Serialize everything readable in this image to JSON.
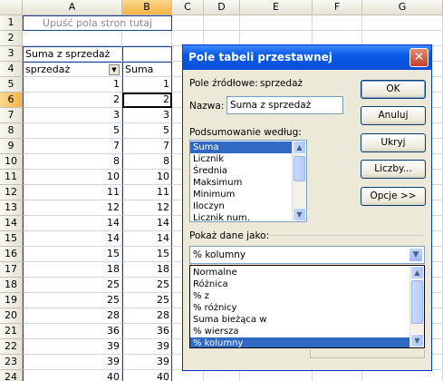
{
  "sheet": {
    "columns": [
      "A",
      "B",
      "C",
      "D",
      "E",
      "F",
      "G"
    ],
    "selected_column": "B",
    "rows": [
      "1",
      "2",
      "3",
      "4",
      "5",
      "6",
      "7",
      "8",
      "9",
      "10",
      "11",
      "12",
      "13",
      "14",
      "15",
      "16",
      "17",
      "18",
      "19",
      "20",
      "21",
      "22",
      "23",
      "24"
    ],
    "selected_row": "6",
    "page_drop_hint": "Upuść pola stron tutaj",
    "pivot_title": "Suma z sprzedaż",
    "row_field": "sprzedaż",
    "data_header": "Suma",
    "col_a_values": [
      "1",
      "2",
      "3",
      "5",
      "7",
      "8",
      "10",
      "11",
      "12",
      "14",
      "14",
      "15",
      "18",
      "25",
      "25",
      "28",
      "36",
      "39",
      "39",
      "40"
    ],
    "col_b_values": [
      "1",
      "2",
      "3",
      "5",
      "7",
      "8",
      "10",
      "11",
      "12",
      "14",
      "14",
      "15",
      "18",
      "25",
      "25",
      "28",
      "36",
      "39",
      "39",
      "40"
    ]
  },
  "dialog": {
    "title": "Pole tabeli przestawnej",
    "source_field_label": "Pole źródłowe:",
    "source_field_value": "sprzedaż",
    "name_label": "Nazwa:",
    "name_value": "Suma z sprzedaż",
    "summarize_label": "Podsumowanie według:",
    "summarize_items": [
      "Suma",
      "Licznik",
      "Średnia",
      "Maksimum",
      "Minimum",
      "Iloczyn",
      "Licznik num."
    ],
    "summarize_selected": "Suma",
    "show_as_label": "Pokaż dane jako:",
    "show_as_value": "% kolumny",
    "show_as_options": [
      "Normalne",
      "Różnica",
      "% z",
      "% różnicy",
      "Suma bieżąca w",
      "% wiersza",
      "% kolumny"
    ],
    "buttons": {
      "ok": "OK",
      "cancel": "Anuluj",
      "hide": "Ukryj",
      "number": "Liczby...",
      "options": "Opcje >>"
    },
    "colors": {
      "title_bar": "#0a5ae8",
      "selection": "#316ac5",
      "close": "#c6402a"
    }
  }
}
